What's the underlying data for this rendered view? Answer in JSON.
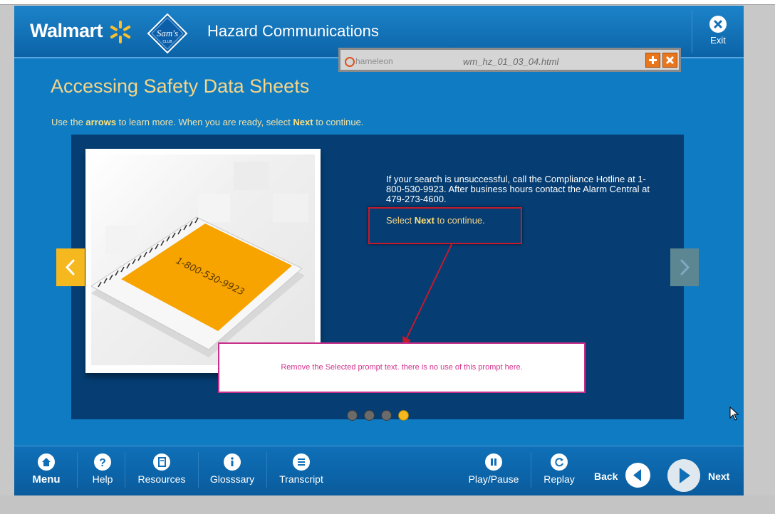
{
  "header": {
    "brand": "Walmart",
    "sams_logo_text": "Sam's",
    "sams_logo_sub": "CLUB",
    "course_title": "Hazard Communications",
    "exit_label": "Exit"
  },
  "chameleon": {
    "logo_text": "hameleon",
    "file_name": "wm_hz_01_03_04.html"
  },
  "content": {
    "page_title": "Accessing Safety Data Sheets",
    "instruction_pre": "Use the ",
    "instruction_arrows": "arrows",
    "instruction_mid": " to learn more.  When you are ready, select ",
    "instruction_next": "Next",
    "instruction_post": " to continue.",
    "body_text": "If your search is unsuccessful, call the Compliance Hotline at 1-800-530-9923.  After business hours contact the Alarm Central at 479-273-4600.",
    "cta_pre": "Select ",
    "cta_next": "Next",
    "cta_post": " to continue.",
    "notepad_number": "1-800-530-9923",
    "review_note": "Remove the Selected prompt text. there is no use of this prompt here.",
    "dots": [
      false,
      false,
      false,
      true
    ]
  },
  "toolbar": {
    "menu": "Menu",
    "help": "Help",
    "resources": "Resources",
    "glossary": "Glosssary",
    "transcript": "Transcript",
    "play_pause": "Play/Pause",
    "replay": "Replay",
    "back": "Back",
    "next": "Next"
  },
  "colors": {
    "app_blue": "#0f7bc3",
    "panel_navy": "#063e73",
    "accent_yellow": "#f6b81f",
    "title_gold": "#f6d587",
    "annotation_red": "#c5192d",
    "annotation_pink": "#d2338d"
  }
}
